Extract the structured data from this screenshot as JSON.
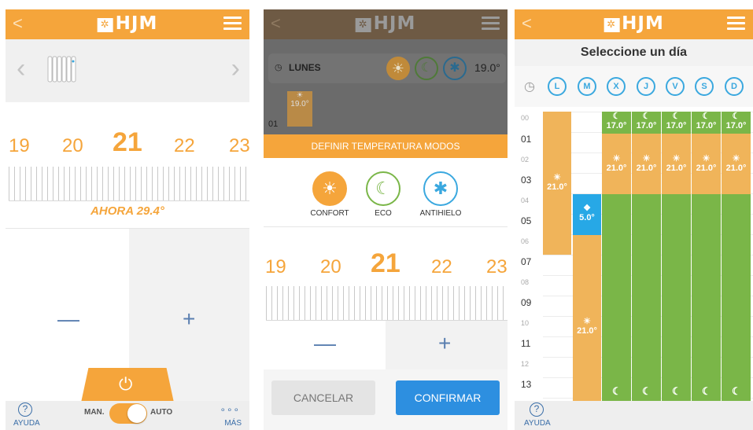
{
  "logo": "HJM",
  "screen1": {
    "scale": [
      "19",
      "20",
      "21",
      "22",
      "23"
    ],
    "now_text": "AHORA 29.4°",
    "minus": "—",
    "plus": "+",
    "footer": {
      "help": "AYUDA",
      "man": "MAN.",
      "auto": "AUTO",
      "more": "MÁS"
    }
  },
  "screen2": {
    "day": "LUNES",
    "day_temp": "19.0°",
    "hour": "01",
    "slot_temp": "19.0°",
    "banner": "DEFINIR TEMPERATURA MODOS",
    "modes": [
      "CONFORT",
      "ECO",
      "ANTIHIELO"
    ],
    "scale": [
      "19",
      "20",
      "21",
      "22",
      "23"
    ],
    "minus": "—",
    "plus": "+",
    "cancel": "CANCELAR",
    "confirm": "CONFIRMAR"
  },
  "screen3": {
    "title": "Seleccione un día",
    "days": [
      "L",
      "M",
      "X",
      "J",
      "V",
      "S",
      "D"
    ],
    "hours": [
      "00",
      "01",
      "02",
      "03",
      "04",
      "05",
      "06",
      "07",
      "08",
      "09",
      "10",
      "11",
      "12",
      "13"
    ],
    "temp_comfort": "21.0°",
    "temp_eco": "17.0°",
    "temp_antifreeze": "5.0°",
    "help": "AYUDA"
  },
  "colors": {
    "orange": "#f5a53b",
    "green": "#7ab648",
    "blue": "#3aa8df",
    "confirm_blue": "#2d8fe0"
  }
}
